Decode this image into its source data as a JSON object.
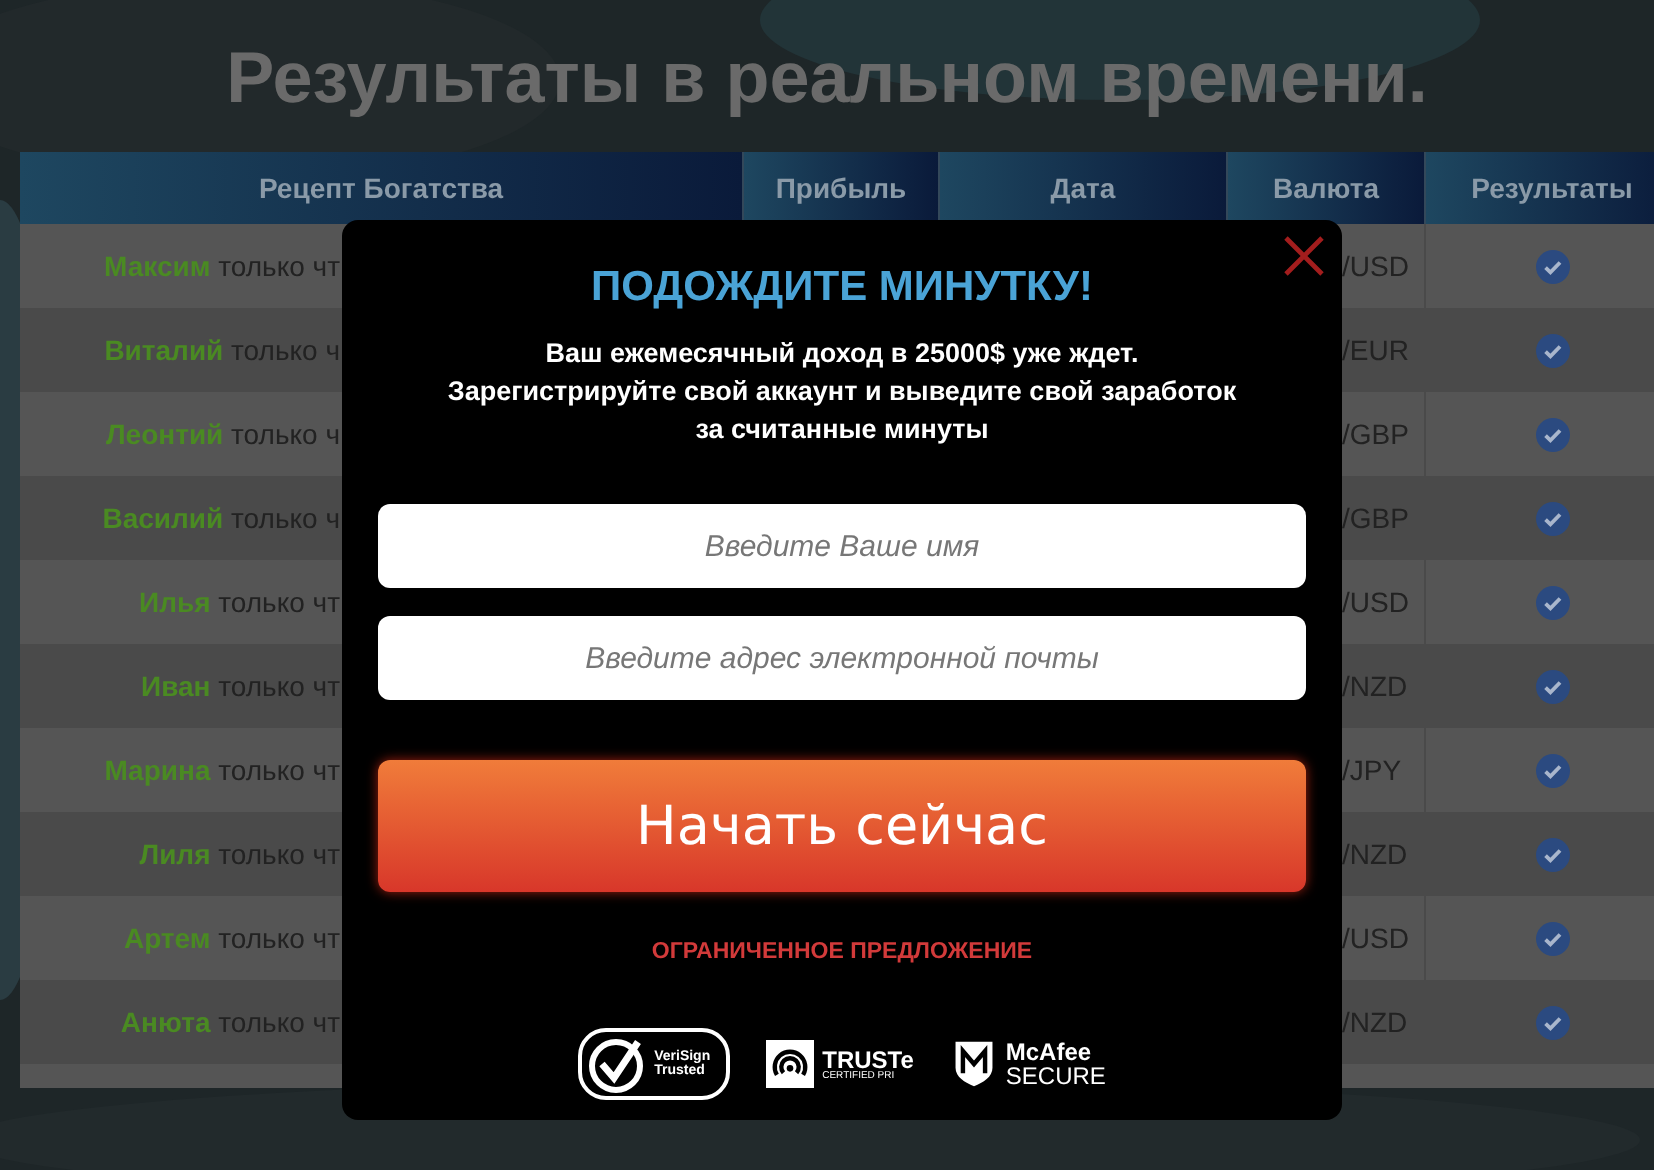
{
  "title": "Результаты в реальном времени.",
  "table": {
    "columns": [
      "Рецепт Богатства",
      "Прибыль",
      "Дата",
      "Валюта",
      "Результаты"
    ],
    "rows": [
      {
        "name": "Максим",
        "action": "только чт",
        "currency": "/USD",
        "checked": true
      },
      {
        "name": "Виталий",
        "action": "только ч",
        "currency": "/EUR",
        "checked": true
      },
      {
        "name": "Леонтий",
        "action": "только ч",
        "currency": "/GBP",
        "checked": true
      },
      {
        "name": "Василий",
        "action": "только ч",
        "currency": "/GBP",
        "checked": true
      },
      {
        "name": "Илья",
        "action": "только чт",
        "currency": "/USD",
        "checked": true
      },
      {
        "name": "Иван",
        "action": "только чт",
        "currency": "/NZD",
        "checked": true
      },
      {
        "name": "Марина",
        "action": "только чт",
        "currency": "/JPY",
        "checked": true
      },
      {
        "name": "Лиля",
        "action": "только чт",
        "currency": "/NZD",
        "checked": true
      },
      {
        "name": "Артем",
        "action": "только чт",
        "currency": "/USD",
        "checked": true
      },
      {
        "name": "Анюта",
        "action": "только чт",
        "currency": "/NZD",
        "checked": true
      }
    ]
  },
  "modal": {
    "heading": "ПОДОЖДИТЕ МИНУТКУ!",
    "message": "Ваш ежемесячный доход в 25000$ уже ждет.\nЗарегистрируйте свой аккаунт и выведите свой заработок\nза считанные минуты",
    "fields": [
      {
        "placeholder": "Введите Ваше имя"
      },
      {
        "placeholder": "Введите адрес электронной почты"
      }
    ],
    "submit": "Начать сейчас",
    "offer": "ОГРАНИЧЕННОЕ ПРЕДЛОЖЕНИЕ",
    "badges": [
      {
        "kind": "verisign",
        "lines": [
          "VeriSign",
          "Trusted"
        ]
      },
      {
        "kind": "truste",
        "lines": [
          "TRUSTe",
          "CERTIFIED PRI"
        ]
      },
      {
        "kind": "mcafee",
        "lines": [
          "McAfee",
          "SECURE"
        ]
      }
    ]
  }
}
